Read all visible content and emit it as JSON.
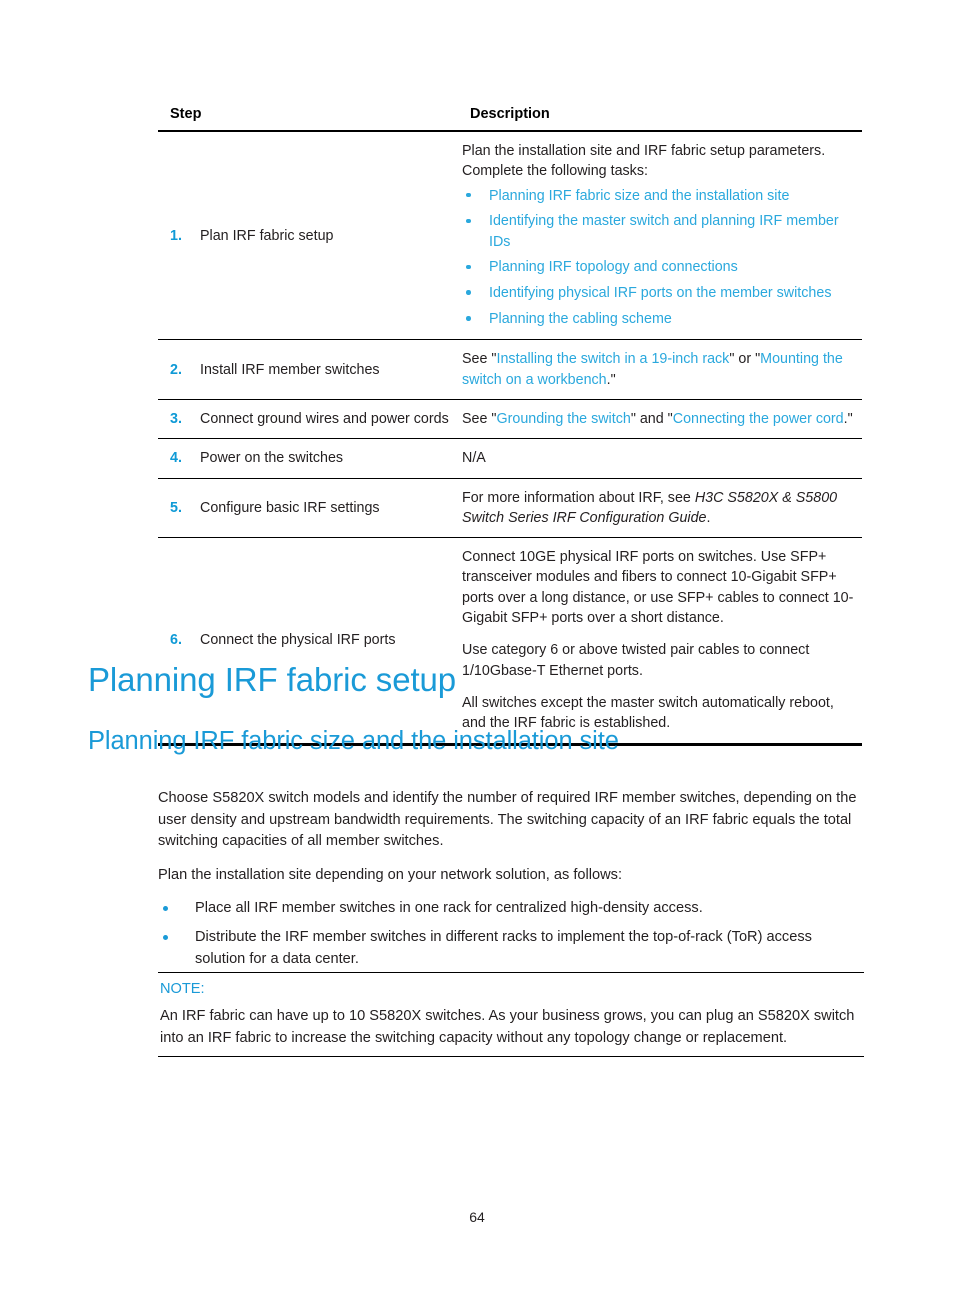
{
  "table": {
    "headers": {
      "step": "Step",
      "description": "Description"
    },
    "rows": [
      {
        "num": "1.",
        "label": "Plan IRF fabric setup",
        "intro_line1": "Plan the installation site and IRF fabric setup parameters.",
        "intro_line2": "Complete the following tasks:",
        "links": [
          "Planning IRF fabric size and the installation site",
          "Identifying the master switch and planning IRF member IDs",
          "Planning IRF topology and connections",
          "Identifying physical IRF ports on the member switches",
          "Planning the cabling scheme"
        ]
      },
      {
        "num": "2.",
        "label": "Install IRF member switches",
        "desc_pre": "See \"",
        "link1": "Installing the switch in a 19-inch rack",
        "desc_mid": "\" or \"",
        "link2": "Mounting the switch on a workbench",
        "desc_post": ".\""
      },
      {
        "num": "3.",
        "label": "Connect ground wires and power cords",
        "desc_pre": "See \"",
        "link1": "Grounding the switch",
        "desc_mid": "\" and \"",
        "link2": "Connecting the power cord",
        "desc_post": ".\""
      },
      {
        "num": "4.",
        "label": "Power on the switches",
        "desc": "N/A"
      },
      {
        "num": "5.",
        "label": "Configure basic IRF settings",
        "desc_pre": "For more information about IRF, see ",
        "desc_italic": "H3C S5820X & S5800 Switch Series IRF Configuration Guide",
        "desc_post": "."
      },
      {
        "num": "6.",
        "label": "Connect the physical IRF ports",
        "para1": "Connect 10GE physical IRF ports on switches. Use SFP+ transceiver modules and fibers to connect 10-Gigabit SFP+ ports over a long distance, or use SFP+ cables to connect 10-Gigabit SFP+ ports over a short distance.",
        "para2": "Use category 6 or above twisted pair cables to connect 1/10Gbase-T Ethernet ports.",
        "para3": "All switches except the master switch automatically reboot, and the IRF fabric is established."
      }
    ]
  },
  "headings": {
    "h1": "Planning IRF fabric setup",
    "h2": "Planning IRF fabric size and the installation site"
  },
  "body": {
    "para1": "Choose S5820X switch models and identify the number of required IRF member switches, depending on the user density and upstream bandwidth requirements. The switching capacity of an IRF fabric equals the total switching capacities of all member switches.",
    "para2": "Plan the installation site depending on your network solution, as follows:",
    "bullets": [
      "Place all IRF member switches in one rack for centralized high-density access.",
      "Distribute the IRF member switches in different racks to implement the top-of-rack (ToR) access solution for a data center."
    ]
  },
  "note": {
    "title": "NOTE:",
    "text": "An IRF fabric can have up to 10 S5820X switches. As your business grows, you can plug an S5820X switch into an IRF fabric to increase the switching capacity without any topology change or replacement."
  },
  "footer": {
    "page_number": "64"
  },
  "colors": {
    "link": "#2aa8dd",
    "heading": "#1a9ad7",
    "text": "#231f20"
  }
}
